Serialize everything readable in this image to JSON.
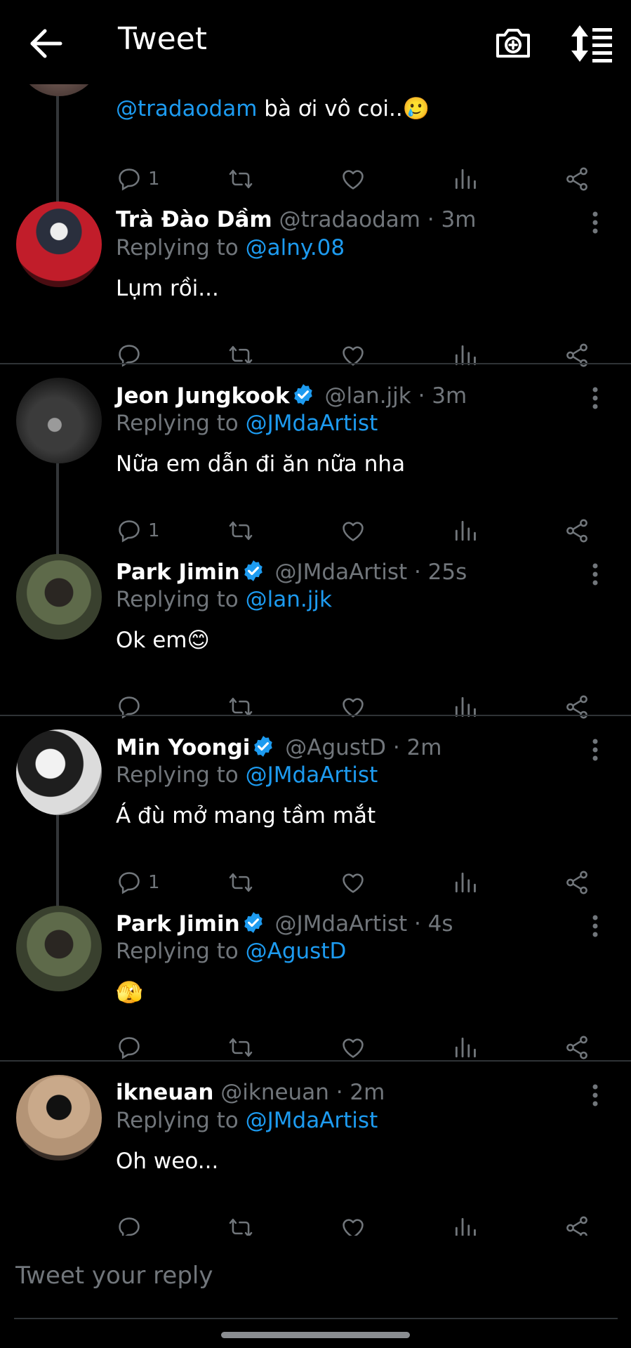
{
  "header": {
    "title": "Tweet",
    "back_icon": "arrow-left-icon",
    "camera_icon": "camera-plus-icon",
    "sort_icon": "sort-icon"
  },
  "colors": {
    "background": "#000000",
    "accent": "#1d9bf0",
    "muted": "#71767b",
    "divider": "#2f3336"
  },
  "tweets": [
    {
      "body_mention": "@tradaodam",
      "body": "bà ơi vô coi..🥲",
      "reply_count": "1"
    },
    {
      "name": "Trà Đào Dầm",
      "handle": "@tradaodam · 3m",
      "replying_label": "Replying to",
      "replying_to": "@alny.08",
      "body": "Lụm rồi..."
    },
    {
      "name": "Jeon Jungkook",
      "handle": "@lan.jjk · 3m",
      "replying_label": "Replying to",
      "replying_to": "@JMdaArtist",
      "body": "Nữa em dẫn đi ăn nữa nha",
      "reply_count": "1"
    },
    {
      "name": "Park Jimin",
      "handle": "@JMdaArtist · 25s",
      "replying_label": "Replying to",
      "replying_to": "@lan.jjk",
      "body": "Ok em😊"
    },
    {
      "name": "Min Yoongi",
      "handle": "@AgustD · 2m",
      "replying_label": "Replying to",
      "replying_to": "@JMdaArtist",
      "body": "Á đù mở mang tầm mắt",
      "reply_count": "1"
    },
    {
      "name": "Park Jimin",
      "handle": "@JMdaArtist · 4s",
      "replying_label": "Replying to",
      "replying_to": "@AgustD",
      "body": "🫣"
    },
    {
      "name": "ikneuan",
      "handle": "@ikneuan · 2m",
      "replying_label": "Replying to",
      "replying_to": "@JMdaArtist",
      "body": "Oh weo..."
    }
  ],
  "reply": {
    "placeholder": "Tweet your reply"
  }
}
